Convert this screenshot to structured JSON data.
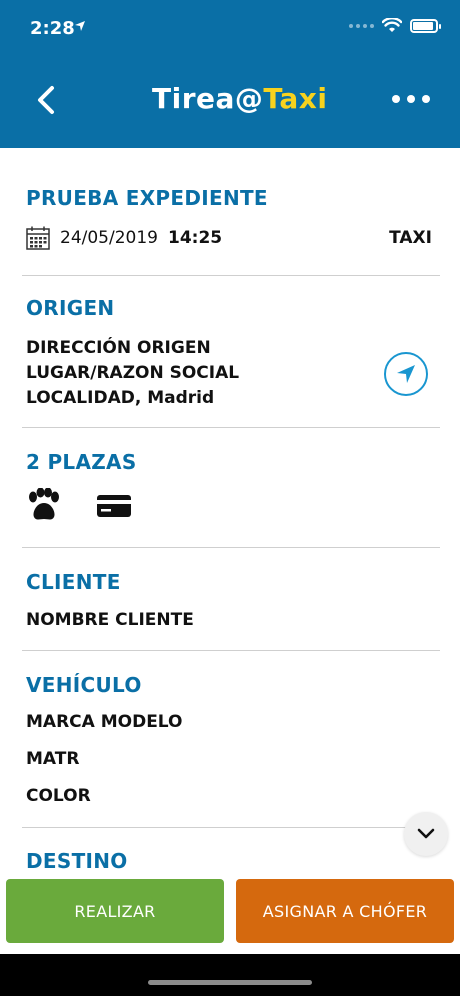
{
  "status_bar": {
    "time": "2:28"
  },
  "header": {
    "brand_white": "Tirea@",
    "brand_yellow": "Taxi"
  },
  "expediente": {
    "title": "PRUEBA EXPEDIENTE",
    "date": "24/05/2019",
    "time": "14:25",
    "service_type": "TAXI"
  },
  "origen": {
    "title": "ORIGEN",
    "address": "DIRECCIÓN ORIGEN",
    "place": "LUGAR/RAZON SOCIAL",
    "locality": "LOCALIDAD, Madrid"
  },
  "plazas": {
    "title": "2 PLAZAS",
    "icons": [
      "paw-icon",
      "credit-card-icon"
    ]
  },
  "cliente": {
    "title": "CLIENTE",
    "name": "NOMBRE CLIENTE"
  },
  "vehiculo": {
    "title": "VEHÍCULO",
    "model": "MARCA MODELO",
    "plate": "MATR",
    "color": "COLOR"
  },
  "destino": {
    "title": "DESTINO"
  },
  "actions": {
    "primary_label": "REALIZAR",
    "secondary_label": "ASIGNAR A CHÓFER"
  },
  "colors": {
    "header": "#0a6fa6",
    "accent": "#0a6fa6",
    "brand_yellow": "#f7d21e",
    "realizar": "#6aaa3c",
    "asignar": "#d5690e"
  }
}
